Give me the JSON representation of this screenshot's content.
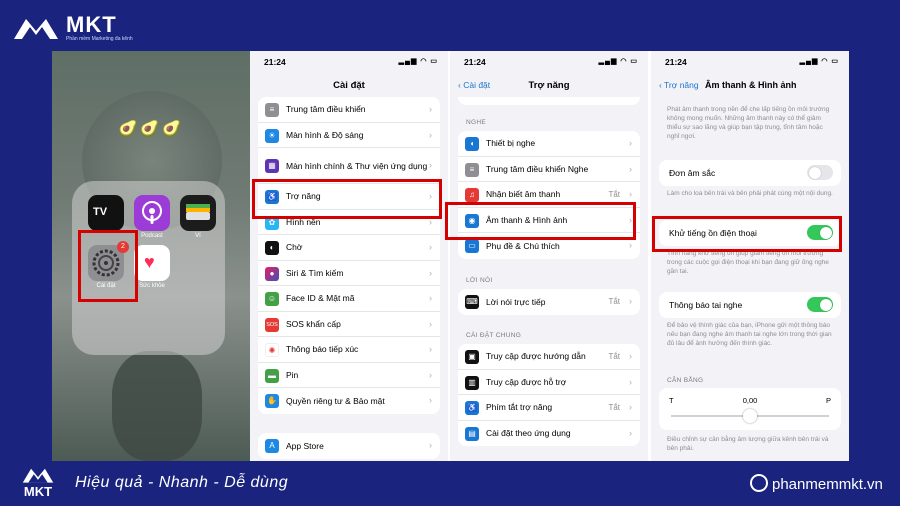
{
  "brand": {
    "name": "MKT",
    "tagline": "Phần mềm Marketing đa kênh",
    "footer_slogan": "Hiệu quả - Nhanh - Dễ dùng",
    "website": "phanmemmkt.vn"
  },
  "home": {
    "emoji": "🥑🥑🥑",
    "apps": [
      {
        "label": "TV",
        "icon": "apple-tv-icon"
      },
      {
        "label": "Podcast",
        "icon": "podcast-icon"
      },
      {
        "label": "Ví",
        "icon": "wallet-icon"
      },
      {
        "label": "Cài đặt",
        "icon": "settings-gear-icon",
        "badge": "2"
      },
      {
        "label": "Sức khỏe",
        "icon": "health-heart-icon"
      }
    ]
  },
  "panel_settings": {
    "time": "21:24",
    "title": "Cài đặt",
    "rows": [
      "Trung tâm điều khiển",
      "Màn hình & Độ sáng",
      "Màn hình chính & Thư viện ứng dụng",
      "Trợ năng",
      "Hình nền",
      "Chờ",
      "Siri & Tìm kiếm",
      "Face ID & Mật mã",
      "SOS khẩn cấp",
      "Thông báo tiếp xúc",
      "Pin",
      "Quyền riêng tư & Bảo mật"
    ],
    "store": "App Store"
  },
  "panel_accessibility": {
    "time": "21:24",
    "back": "Cài đặt",
    "title": "Trợ năng",
    "section_hearing": "NGHE",
    "hearing_rows": [
      {
        "label": "Thiết bị nghe",
        "value": ""
      },
      {
        "label": "Trung tâm điều khiển Nghe",
        "value": ""
      },
      {
        "label": "Nhận biết âm thanh",
        "value": "Tắt"
      },
      {
        "label": "Âm thanh & Hình ảnh",
        "value": ""
      },
      {
        "label": "Phụ đề & Chú thích",
        "value": ""
      }
    ],
    "section_speech": "LỜI NÓI",
    "speech_rows": [
      {
        "label": "Lời nói trực tiếp",
        "value": "Tắt"
      }
    ],
    "section_general": "CÀI ĐẶT CHUNG",
    "general_rows": [
      {
        "label": "Truy cập được hướng dẫn",
        "value": "Tắt"
      },
      {
        "label": "Truy cập được hỗ trợ",
        "value": ""
      },
      {
        "label": "Phím tắt trợ năng",
        "value": "Tắt"
      },
      {
        "label": "Cài đặt theo ứng dụng",
        "value": ""
      }
    ]
  },
  "panel_audio": {
    "time": "21:24",
    "back": "Trợ năng",
    "title": "Âm thanh & Hình ảnh",
    "intro": "Phát âm thanh trong nền để che lấp tiếng ồn môi trường không mong muốn. Những âm thanh này có thể giảm thiểu sự sao lãng và giúp bạn tập trung, tĩnh tâm hoặc nghỉ ngơi.",
    "mono_label": "Đơn âm sắc",
    "mono_on": false,
    "mono_note": "Làm cho loa bên trái và bên phải phát cùng một nội dung.",
    "noise_label": "Khử tiếng ồn điện thoại",
    "noise_on": true,
    "noise_note": "Tính năng khử tiếng ồn giúp giảm tiếng ồn môi trường trong các cuộc gọi điện thoại khi bạn đang giữ ống nghe gần tai.",
    "headphone_label": "Thông báo tai nghe",
    "headphone_on": true,
    "headphone_note": "Để bảo vệ thính giác của bạn, iPhone gửi một thông báo nếu bạn đang nghe âm thanh tai nghe lớn trong thời gian đủ lâu để ảnh hưởng đến thính giác.",
    "balance_section": "CÂN BẰNG",
    "balance_left": "T",
    "balance_right": "P",
    "balance_value": "0,00",
    "balance_fraction": 0.5,
    "balance_note": "Điều chỉnh sự cân bằng âm lượng giữa kênh bên trái và bên phải."
  },
  "colors": {
    "accent": "#1976d2",
    "toggle_on": "#34c759",
    "highlight": "#d50000",
    "brand_bg": "#1a237e"
  }
}
